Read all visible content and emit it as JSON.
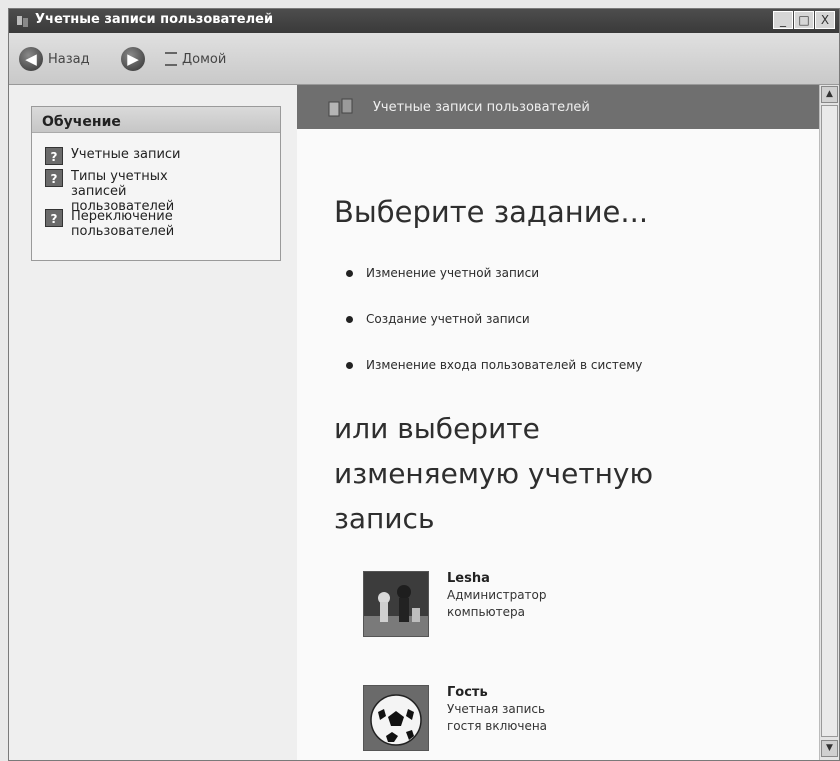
{
  "window": {
    "title": "Учетные записи пользователей",
    "controls": {
      "minimize": "_",
      "maximize": "□",
      "close": "X"
    }
  },
  "toolbar": {
    "back_label": "Назад",
    "home_label": "Домой",
    "back_icon": "arrow-left",
    "forward_icon": "arrow-right",
    "home_icon": "home"
  },
  "learn_panel": {
    "header": "Обучение",
    "items": [
      {
        "label": "Учетные записи"
      },
      {
        "label": "Типы учетных записей пользователей"
      },
      {
        "label": "Переключение пользователей"
      }
    ]
  },
  "banner": {
    "title": "Учетные записи пользователей"
  },
  "main": {
    "heading_task": "Выберите задание...",
    "tasks": [
      {
        "label": "Изменение учетной записи"
      },
      {
        "label": "Создание учетной записи"
      },
      {
        "label": "Изменение входа пользователей в систему"
      }
    ],
    "heading_account": "или выберите изменяемую учетную запись",
    "accounts": [
      {
        "name": "Lesha",
        "description": "Администратор компьютера",
        "picture": "chess"
      },
      {
        "name": "Гость",
        "description": "Учетная запись гостя включена",
        "picture": "soccer-ball"
      }
    ]
  },
  "scrollbar": {
    "up": "▲",
    "down": "▼"
  }
}
